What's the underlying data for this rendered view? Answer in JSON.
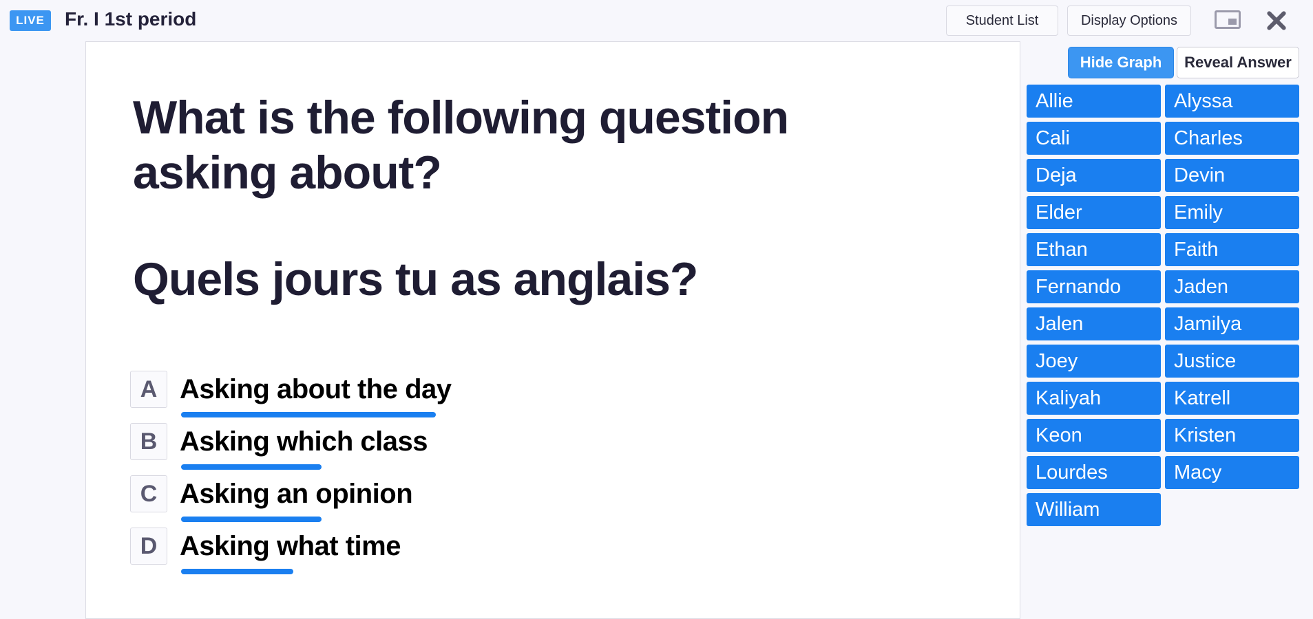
{
  "header": {
    "live_badge": "LIVE",
    "class_title": "Fr. I 1st period",
    "buttons": {
      "student_list": "Student List",
      "display_options": "Display Options"
    },
    "icons": [
      "picture-in-picture-icon",
      "close-icon"
    ]
  },
  "question": {
    "prompt": "What is the following question asking about?",
    "french": "Quels jours tu as anglais?",
    "answers": [
      {
        "letter": "A",
        "text": "Asking about the day",
        "response_share": 1.0
      },
      {
        "letter": "B",
        "text": "Asking which class",
        "response_share": 0.55
      },
      {
        "letter": "C",
        "text": "Asking an opinion",
        "response_share": 0.55
      },
      {
        "letter": "D",
        "text": "Asking what time",
        "response_share": 0.44
      }
    ]
  },
  "controls": {
    "hide_graph": "Hide Graph",
    "reveal_answer": "Reveal Answer"
  },
  "students": [
    "Allie",
    "Alyssa",
    "Cali",
    "Charles",
    "Deja",
    "Devin",
    "Elder",
    "Emily",
    "Ethan",
    "Faith",
    "Fernando",
    "Jaden",
    "Jalen",
    "Jamilya",
    "Joey",
    "Justice",
    "Kaliyah",
    "Katrell",
    "Keon",
    "Kristen",
    "Lourdes",
    "Macy",
    "William"
  ],
  "colors": {
    "accent": "#1a7ff0",
    "live_badge": "#3c96f2",
    "background": "#f7f7fc"
  }
}
